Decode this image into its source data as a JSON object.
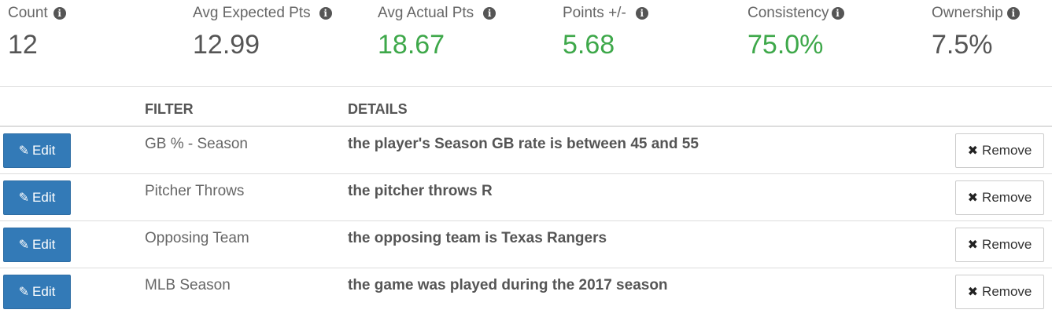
{
  "stats": [
    {
      "label": "Count",
      "value": "12",
      "highlight": false,
      "info_icon": "info-circle-icon"
    },
    {
      "label": "Avg Expected Pts",
      "value": "12.99",
      "highlight": false,
      "info_icon": "info-circle-icon"
    },
    {
      "label": "Avg Actual Pts",
      "value": "18.67",
      "highlight": true,
      "info_icon": "info-circle-icon"
    },
    {
      "label": "Points +/-",
      "value": "5.68",
      "highlight": true,
      "info_icon": "info-circle-icon"
    },
    {
      "label": "Consistency",
      "value": "75.0%",
      "highlight": true,
      "info_icon": "info-circle-icon"
    },
    {
      "label": "Ownership",
      "value": "7.5%",
      "highlight": false,
      "info_icon": "info-circle-icon"
    }
  ],
  "table": {
    "columns": {
      "filter": "FILTER",
      "details": "DETAILS"
    },
    "edit_label": "Edit",
    "remove_label": "Remove",
    "rows": [
      {
        "filter": "GB % - Season",
        "details": "the player's Season GB rate is between 45 and 55"
      },
      {
        "filter": "Pitcher Throws",
        "details": "the pitcher throws R"
      },
      {
        "filter": "Opposing Team",
        "details": "the opposing team is Texas Rangers"
      },
      {
        "filter": "MLB Season",
        "details": "the game was played during the 2017 season"
      }
    ]
  },
  "colors": {
    "good": "#3ea84a",
    "primary_button": "#337ab7"
  }
}
